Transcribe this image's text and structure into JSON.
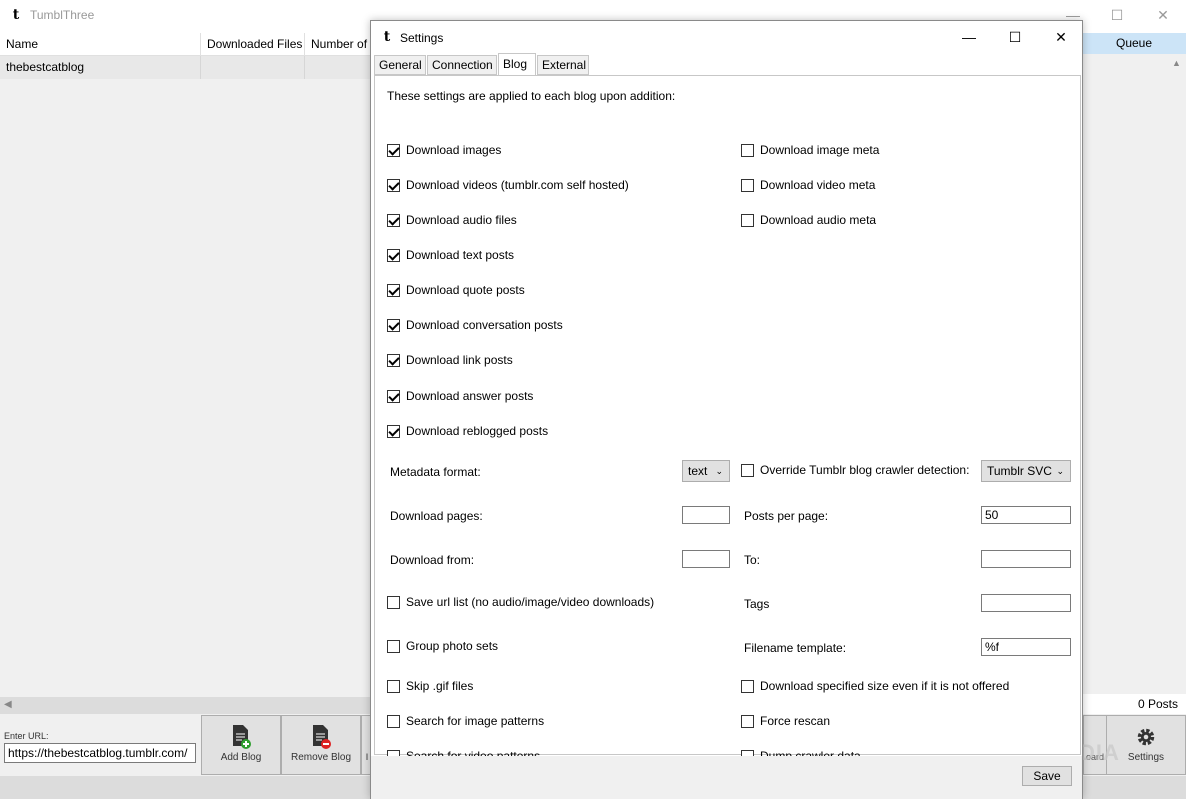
{
  "main": {
    "title": "TumblThree",
    "grid": {
      "columns": [
        "Name",
        "Downloaded Files",
        "Number of"
      ],
      "rows": [
        [
          "thebestcatblog",
          "",
          ""
        ]
      ]
    },
    "queue": {
      "header": "Queue",
      "status": "0 Posts"
    },
    "url": {
      "label": "Enter URL:",
      "value": "https://thebestcatblog.tumblr.com/"
    },
    "toolbar": {
      "add_blog": "Add Blog",
      "remove_blog": "Remove Blog",
      "partial": "I",
      "clipboard_partial": "oard",
      "settings": "Settings"
    },
    "watermark": "SOFTPEDIA",
    "colors": {
      "queue_header": "#cce4f7",
      "row_selected": "#e8e8e8"
    }
  },
  "dialog": {
    "title": "Settings",
    "tabs": [
      {
        "label": "General",
        "active": false
      },
      {
        "label": "Connection",
        "active": false
      },
      {
        "label": "Blog",
        "active": true
      },
      {
        "label": "External",
        "active": false
      }
    ],
    "intro": "These settings are applied to each blog upon addition:",
    "left_checks": [
      {
        "label": "Download images",
        "checked": true
      },
      {
        "label": "Download videos (tumblr.com self hosted)",
        "checked": true
      },
      {
        "label": "Download audio files",
        "checked": true
      },
      {
        "label": "Download text posts",
        "checked": true
      },
      {
        "label": "Download quote posts",
        "checked": true
      },
      {
        "label": "Download conversation posts",
        "checked": true
      },
      {
        "label": "Download link posts",
        "checked": true
      },
      {
        "label": "Download answer posts",
        "checked": true
      },
      {
        "label": "Download reblogged posts",
        "checked": true
      }
    ],
    "right_checks": [
      {
        "label": "Download image meta",
        "checked": false
      },
      {
        "label": "Download video meta",
        "checked": false
      },
      {
        "label": "Download audio meta",
        "checked": false
      }
    ],
    "metadata_format": {
      "label": "Metadata format:",
      "value": "text"
    },
    "override_crawler": {
      "label": "Override Tumblr blog crawler detection:",
      "checked": false,
      "value": "Tumblr SVC"
    },
    "download_pages": {
      "label": "Download pages:",
      "value": ""
    },
    "posts_per_page": {
      "label": "Posts per page:",
      "value": "50"
    },
    "download_from": {
      "label": "Download from:",
      "value": ""
    },
    "to": {
      "label": "To:",
      "value": ""
    },
    "save_url_list": {
      "label": "Save url list (no audio/image/video downloads)",
      "checked": false
    },
    "tags": {
      "label": "Tags",
      "value": ""
    },
    "group_photo_sets": {
      "label": "Group photo sets",
      "checked": false
    },
    "filename_template": {
      "label": "Filename template:",
      "value": "%f"
    },
    "skip_gif": {
      "label": "Skip .gif files",
      "checked": false
    },
    "download_specified_size": {
      "label": "Download specified size even if it is not offered",
      "checked": false
    },
    "search_image_patterns": {
      "label": "Search for image patterns",
      "checked": false
    },
    "force_rescan": {
      "label": "Force rescan",
      "checked": false
    },
    "search_video_patterns": {
      "label": "Search for video patterns",
      "checked": false
    },
    "dump_crawler_data": {
      "label": "Dump crawler data",
      "checked": false
    },
    "save_label": "Save"
  }
}
